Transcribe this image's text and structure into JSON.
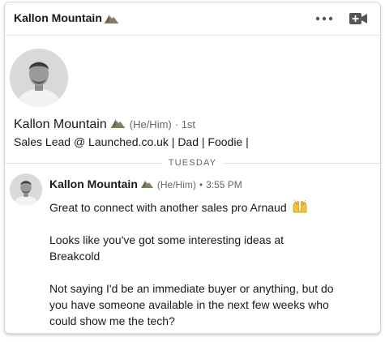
{
  "header": {
    "title": "Kallon Mountain",
    "title_emoji": "mountain-emoji",
    "more_icon": "more-horizontal-icon",
    "video_icon": "video-call-icon"
  },
  "profile": {
    "name": "Kallon Mountain",
    "pronouns": "(He/Him)",
    "degree": "· 1st",
    "headline": "Sales Lead @ Launched.co.uk | Dad | Foodie |"
  },
  "divider": {
    "label": "TUESDAY"
  },
  "message": {
    "sender": "Kallon Mountain",
    "pronouns": "(He/Him)",
    "bullet": "•",
    "time": "3:55 PM",
    "lines": [
      "Great to connect with another sales pro Arnaud",
      "Looks like you've got some interesting ideas at Breakcold",
      "Not saying I'd be an immediate buyer or anything, but do you have someone available in the next few weeks who could show me the tech?"
    ],
    "first_line_emoji": "raised-hands-emoji"
  },
  "colors": {
    "text": "#191919",
    "muted": "#666666",
    "border": "#d6d6d6",
    "divider": "#e0e0e0"
  }
}
